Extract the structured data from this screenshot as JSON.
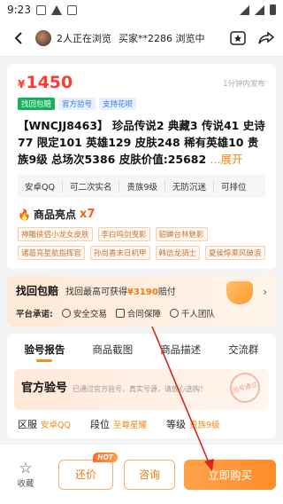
{
  "status_bar": {
    "time": "9:23"
  },
  "header": {
    "viewers": "2人正在浏览",
    "buyer_info": "买家**2286 浏览中"
  },
  "listing": {
    "price_symbol": "¥",
    "price": "1450",
    "posted": "1分钟内发布",
    "tags": [
      "找回包赔",
      "官方验号",
      "支持花呗"
    ],
    "title": "【WNCJJ8463】 珍品传说2 典藏3 传说41 史诗77 限定101 英雄129 皮肤248  稀有英雄10 贵族9级  总场次5386 皮肤价值:25682",
    "title_more": "...展开",
    "attributes": [
      "安卓QQ",
      "可二次实名",
      "贵族9级",
      "无防沉迷",
      "可排位"
    ]
  },
  "highlights": {
    "label": "商品亮点",
    "count": "x7",
    "items": [
      "神雕侠侣小龙女皮肤",
      "李白鸣剑曳影",
      "貂蝉台林魅影",
      "诸葛亮星航指挥官",
      "孙尚香末日机甲",
      "韩信龙骑士",
      "夏侯惇乘风破浪"
    ]
  },
  "guarantee": {
    "title": "找回包赔",
    "text_prefix": "找回最高可获得",
    "amount": "¥3190",
    "text_suffix": "赔付",
    "promise_label": "平台承诺:",
    "promises": [
      "安全交易",
      "合同保障",
      "千人团队"
    ]
  },
  "tabs": [
    "验号报告",
    "商品截图",
    "商品描述",
    "交流群"
  ],
  "report": {
    "title": "官方验号",
    "desc": "已通过官方验号，真实号源，请放心选购！",
    "stamp": "验号通过",
    "fields": [
      {
        "key": "区服",
        "value": "安卓QQ"
      },
      {
        "key": "段位",
        "value": "至尊星耀"
      },
      {
        "key": "等级",
        "value": "贵族9级"
      }
    ]
  },
  "bottom_bar": {
    "favorite": "收藏",
    "haggle": "还价",
    "hot_badge": "HOT",
    "consult": "咨询",
    "buy": "立即购买"
  },
  "colors": {
    "accent": "#ff8c2a",
    "price": "#ff3b30",
    "annotation_arrow": "#d9261c"
  }
}
